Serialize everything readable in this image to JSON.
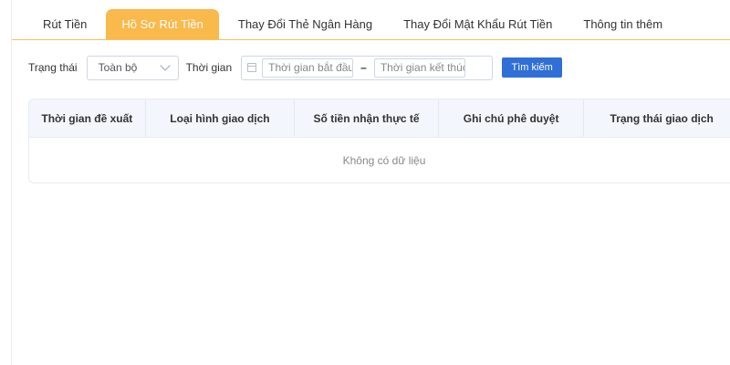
{
  "tabs": [
    {
      "label": "Rút Tiền",
      "active": false
    },
    {
      "label": "Hồ Sơ Rút Tiền",
      "active": true
    },
    {
      "label": "Thay Đổi Thẻ Ngân Hàng",
      "active": false
    },
    {
      "label": "Thay Đổi Mật Khẩu Rút Tiền",
      "active": false
    },
    {
      "label": "Thông tin thêm",
      "active": false
    }
  ],
  "filters": {
    "status_label": "Trạng thái",
    "status_value": "Toàn bộ",
    "time_label": "Thời gian",
    "start_placeholder": "Thời gian bắt đầu",
    "range_separator": "–",
    "end_placeholder": "Thời gian kết thúc",
    "search_button": "Tìm kiếm"
  },
  "table": {
    "columns": [
      "Thời gian đề xuất",
      "Loại hình giao dịch",
      "Số tiền nhận thực tế",
      "Ghi chú phê duyệt",
      "Trạng thái giao dịch"
    ],
    "empty_text": "Không có dữ liệu"
  },
  "colors": {
    "active_tab": "#f9b94b",
    "accent_line": "#f3c35a",
    "primary_button": "#2f6fd7",
    "header_bg": "#f3f6fc"
  },
  "icons": {
    "calendar": "calendar-icon",
    "dropdown": "chevron-down-icon"
  }
}
